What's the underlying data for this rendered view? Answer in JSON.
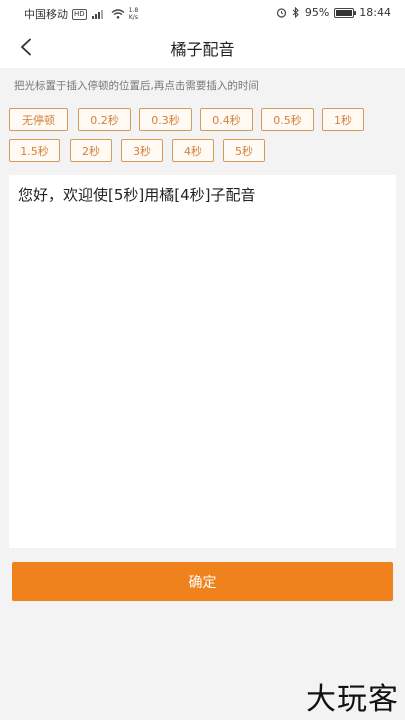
{
  "status_bar": {
    "carrier": "中国移动",
    "hd": "HD",
    "net_speed_value": "1.8",
    "net_speed_unit": "K/s",
    "battery": "95%",
    "time": "18:44"
  },
  "nav": {
    "title": "橘子配音"
  },
  "hint": "把光标置于插入停顿的位置后,再点击需要插入的时间",
  "pause_options_row1": [
    "无停顿",
    "0.2秒",
    "0.3秒",
    "0.4秒",
    "0.5秒",
    "1秒"
  ],
  "pause_options_row2": [
    "1.5秒",
    "2秒",
    "3秒",
    "4秒",
    "5秒"
  ],
  "editor": {
    "text": "您好，欢迎使[5秒]用橘[4秒]子配音"
  },
  "confirm_label": "确定",
  "watermark": "大玩客",
  "colors": {
    "accent": "#f0821e",
    "chip_border": "#d49b5c",
    "chip_text": "#d4803a"
  }
}
